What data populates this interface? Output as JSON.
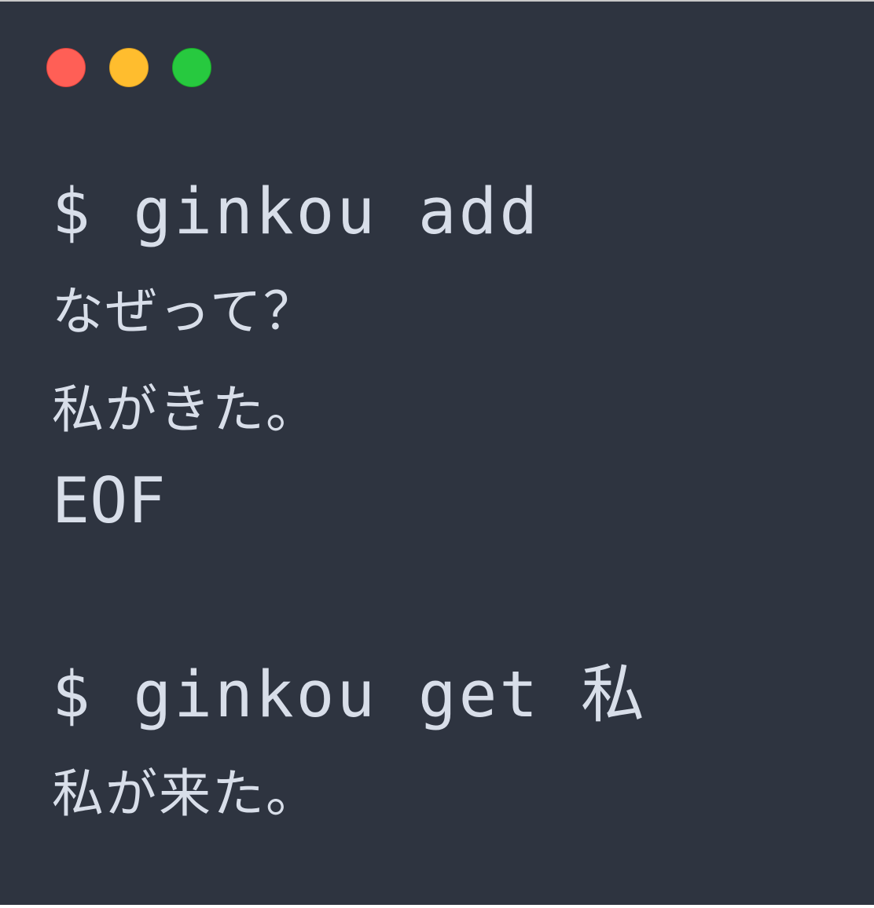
{
  "window": {
    "controls": {
      "close_color": "#ff5f56",
      "minimize_color": "#ffbd2e",
      "maximize_color": "#27c93f"
    },
    "background_color": "#2e3440",
    "text_color": "#d8dee9"
  },
  "terminal": {
    "lines": [
      "$ ginkou add",
      "なぜって？",
      "私がきた。",
      "EOF",
      "$ ginkou get 私",
      "私が来た。"
    ]
  }
}
